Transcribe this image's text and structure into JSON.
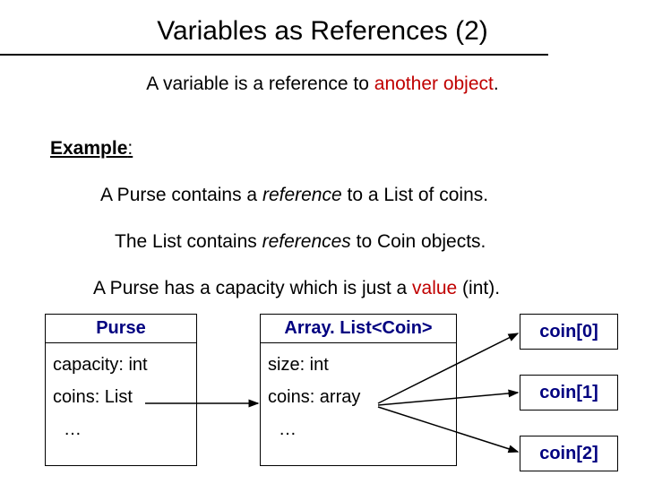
{
  "title": "Variables as References (2)",
  "subtitle_pre": "A variable is a reference to ",
  "subtitle_red": "another object",
  "subtitle_post": ".",
  "example_label": "Example",
  "example_colon": ":",
  "line1_pre": "A Purse contains a ",
  "line1_italic": "reference",
  "line1_post": " to a List of coins.",
  "line2_pre": "The List contains ",
  "line2_italic": "references",
  "line2_post": " to Coin objects.",
  "line3_pre": "A Purse has a capacity which is just a ",
  "line3_red": "value",
  "line3_post": " (int).",
  "purse": {
    "head": "Purse",
    "row1": "capacity: int",
    "row2": "coins: List",
    "row3": "…"
  },
  "arraylist": {
    "head": "Array. List<Coin>",
    "row1": "size: int",
    "row2": "coins: array",
    "row3": "…"
  },
  "coins": {
    "c0": "coin[0]",
    "c1": "coin[1]",
    "c2": "coin[2]"
  }
}
